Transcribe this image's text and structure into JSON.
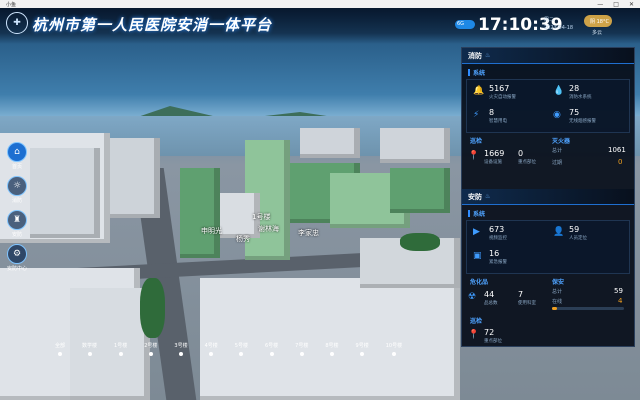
{
  "window": {
    "title": "小鱼",
    "controls": [
      "—",
      "□",
      "✕"
    ]
  },
  "header": {
    "title": "杭州市第一人民医院安消一体平台",
    "toggle_label": "6G",
    "time": "17:10:39",
    "weekday": "周二",
    "date": "2023-04-18",
    "weather": "阴  18°C",
    "weather_sub": "多云"
  },
  "nav": [
    {
      "label": "首页",
      "icon": "home-icon",
      "glyph": "⌂"
    },
    {
      "label": "消防",
      "icon": "fire-icon",
      "glyph": "☼"
    },
    {
      "label": "安防",
      "icon": "shield-icon",
      "glyph": "♜"
    },
    {
      "label": "安防中心",
      "icon": "settings-icon",
      "glyph": "⚙"
    }
  ],
  "map_markers": [
    "1号楼",
    "谢林海",
    "李家忠",
    "申明光",
    "杨秀"
  ],
  "floor_tabs": [
    "全部",
    "数学楼",
    "1号楼",
    "2号楼",
    "3号楼",
    "4号楼",
    "5号楼",
    "6号楼",
    "7号楼",
    "8号楼",
    "9号楼",
    "10号楼"
  ],
  "fire": {
    "title": "消防",
    "system_label": "系统",
    "alarm_count": "5167",
    "alarm_caption": "火灾自动报警",
    "water_count": "28",
    "water_caption": "消防水系统",
    "smoke_count": "8",
    "smoke_caption": "智慧用电",
    "mist_count": "75",
    "mist_caption": "无线烟感报警",
    "patrol_label": "巡检",
    "device_count": "1669",
    "device_zero": "0",
    "device_caption": "设备设施",
    "key_caption": "重点部位",
    "disaster_label": "灭火器",
    "total_label": "总计",
    "total_value": "1061",
    "expired_label": "过期",
    "expired_value": "0"
  },
  "security": {
    "title": "安防",
    "system_label": "系统",
    "video_count": "673",
    "video_caption": "视频监控",
    "person_count": "59",
    "person_caption": "人员定位",
    "alarm_count": "16",
    "alarm_caption": "紧急报警",
    "hazard_label": "危化品",
    "hazard_total": "44",
    "hazard_total_caption": "品总数",
    "hazard_use": "7",
    "hazard_use_caption": "使用科室",
    "guard_label": "保安",
    "guard_total_label": "总计",
    "guard_total": "59",
    "guard_online_label": "在线",
    "guard_online": "4",
    "guard_online_ratio": 0.07,
    "patrol_label": "巡检",
    "patrol_count": "72",
    "patrol_caption": "重点部位"
  }
}
